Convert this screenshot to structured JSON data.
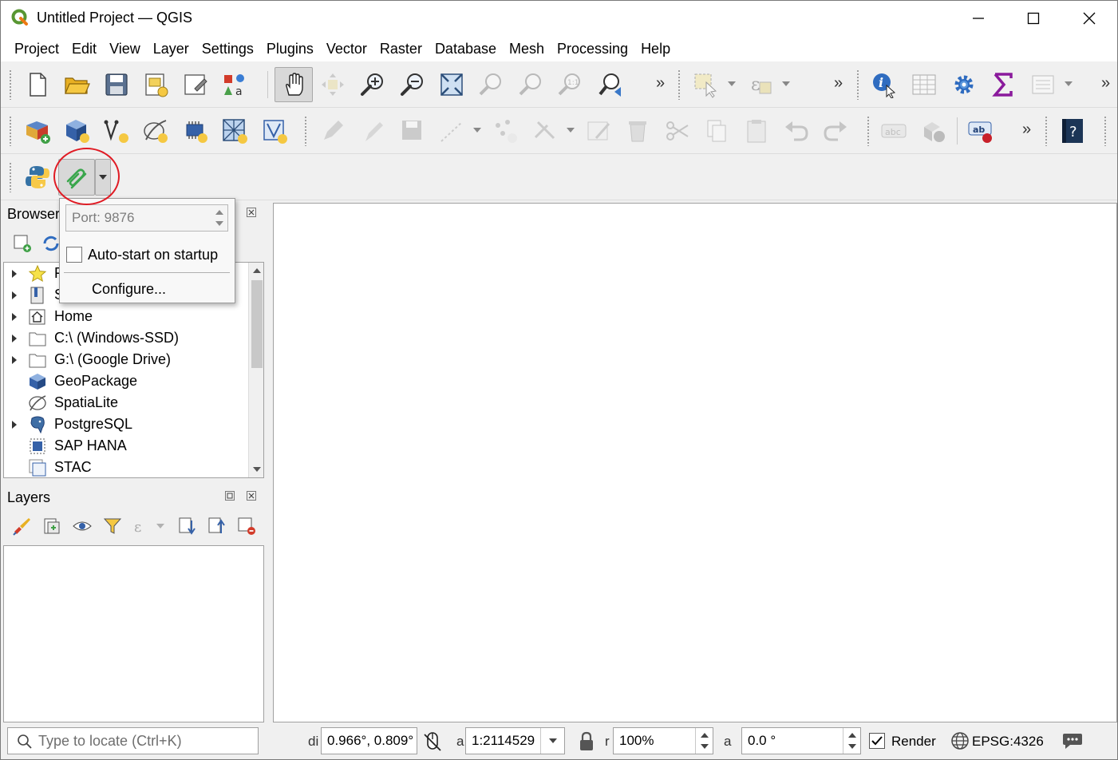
{
  "window": {
    "title": "Untitled Project — QGIS",
    "controls": [
      "minimize-icon",
      "maximize-icon",
      "close-icon"
    ]
  },
  "menubar": {
    "items": [
      "Project",
      "Edit",
      "View",
      "Layer",
      "Settings",
      "Plugins",
      "Vector",
      "Raster",
      "Database",
      "Mesh",
      "Processing",
      "Help"
    ]
  },
  "toolbars": {
    "row1": [
      "new-project-icon",
      "open-project-icon",
      "save-project-icon",
      "new-print-layout-icon",
      "layout-manager-icon",
      "style-manager-icon",
      "pan-icon",
      "pan-to-selection-icon",
      "zoom-in-icon",
      "zoom-out-icon",
      "zoom-full-icon",
      "zoom-to-selection-icon",
      "zoom-to-layer-icon",
      "zoom-native-icon",
      "zoom-last-icon",
      "select-features-icon",
      "select-by-expression-icon",
      "identify-icon",
      "attribute-table-icon",
      "settings-gear-icon",
      "statistics-sigma-icon",
      "toolbox-icon"
    ],
    "row2": [
      "data-source-manager-icon",
      "new-geopackage-icon",
      "new-shapefile-icon",
      "new-spatialite-icon",
      "new-virtual-layer-icon",
      "new-mesh-icon",
      "new-vertex-icon",
      "toggle-editing-icon",
      "current-edits-icon",
      "save-edits-icon",
      "digitize-icon",
      "vertex-tool-icon",
      "multi-edit-icon",
      "modify-attributes-icon",
      "delete-selected-icon",
      "cut-features-icon",
      "copy-features-icon",
      "paste-features-icon",
      "undo-icon",
      "redo-icon",
      "label-icon",
      "diagram-icon",
      "label-toolbar-icon",
      "help-icon"
    ],
    "row3": [
      "python-icon",
      "plugin-server-icon"
    ]
  },
  "browser": {
    "title": "Browser",
    "items": [
      {
        "label": "F",
        "icon": "star-icon",
        "expandable": true
      },
      {
        "label": "S",
        "icon": "bookmark-icon",
        "expandable": true
      },
      {
        "label": "Home",
        "icon": "home-icon",
        "expandable": true
      },
      {
        "label": "C:\\ (Windows-SSD)",
        "icon": "folder-icon",
        "expandable": true
      },
      {
        "label": "G:\\ (Google Drive)",
        "icon": "folder-icon",
        "expandable": true
      },
      {
        "label": "GeoPackage",
        "icon": "geopackage-icon",
        "expandable": false
      },
      {
        "label": "SpatiaLite",
        "icon": "spatialite-icon",
        "expandable": false
      },
      {
        "label": "PostgreSQL",
        "icon": "postgresql-icon",
        "expandable": true
      },
      {
        "label": "SAP HANA",
        "icon": "sap-hana-icon",
        "expandable": false
      },
      {
        "label": "STAC",
        "icon": "stac-icon",
        "expandable": false
      }
    ]
  },
  "layers": {
    "title": "Layers"
  },
  "plugin_popup": {
    "port_placeholder": "Port: 9876",
    "autostart_label": "Auto-start on startup",
    "autostart_checked": false,
    "configure_label": "Configure..."
  },
  "statusbar": {
    "locator_placeholder": "Type to locate (Ctrl+K)",
    "coordinate_label": "di",
    "coordinate_value": "0.966°, 0.809°",
    "scale_label": "a",
    "scale_value": "1:2114529",
    "magnifier_label": "r",
    "magnifier_value": "100%",
    "rotation_label": "a",
    "rotation_value": "0.0 °",
    "render_label": "Render",
    "render_checked": true,
    "crs_label": "EPSG:4326"
  },
  "colors": {
    "highlight_circle": "#e01b24",
    "plugin_green": "#3aa64c",
    "qgis_green": "#589632"
  }
}
